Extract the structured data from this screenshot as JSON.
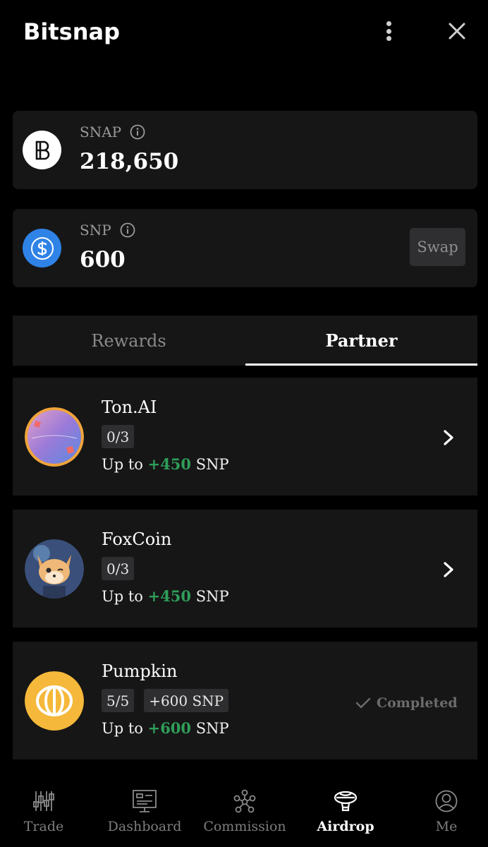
{
  "app": {
    "title": "Bitsnap"
  },
  "balances": [
    {
      "label": "SNAP",
      "value": "218,650",
      "icon": "bitsnap-logo-icon"
    },
    {
      "label": "SNP",
      "value": "600",
      "icon": "snp-coin-icon",
      "action": "Swap"
    }
  ],
  "tabs": [
    {
      "label": "Rewards",
      "active": false
    },
    {
      "label": "Partner",
      "active": true
    }
  ],
  "tasks": [
    {
      "name": "Ton.AI",
      "progress": "0/3",
      "reward_prefix": "Up to",
      "reward_amount": "+450",
      "reward_unit": "SNP",
      "status": "open"
    },
    {
      "name": "FoxCoin",
      "progress": "0/3",
      "reward_prefix": "Up to",
      "reward_amount": "+450",
      "reward_unit": "SNP",
      "status": "open"
    },
    {
      "name": "Pumpkin",
      "progress": "5/5",
      "earned": "+600 SNP",
      "reward_prefix": "Up to",
      "reward_amount": "+600",
      "reward_unit": "SNP",
      "status_label": "Completed"
    }
  ],
  "nav": [
    {
      "label": "Trade",
      "icon": "candlestick-icon"
    },
    {
      "label": "Dashboard",
      "icon": "dashboard-icon"
    },
    {
      "label": "Commission",
      "icon": "network-icon"
    },
    {
      "label": "Airdrop",
      "icon": "airship-icon",
      "active": true
    },
    {
      "label": "Me",
      "icon": "profile-icon"
    }
  ],
  "colors": {
    "accent_green": "#2f9e5a",
    "card_bg": "#161616",
    "snp_blue": "#2f82e6",
    "pumpkin_yellow": "#f5b83a"
  }
}
